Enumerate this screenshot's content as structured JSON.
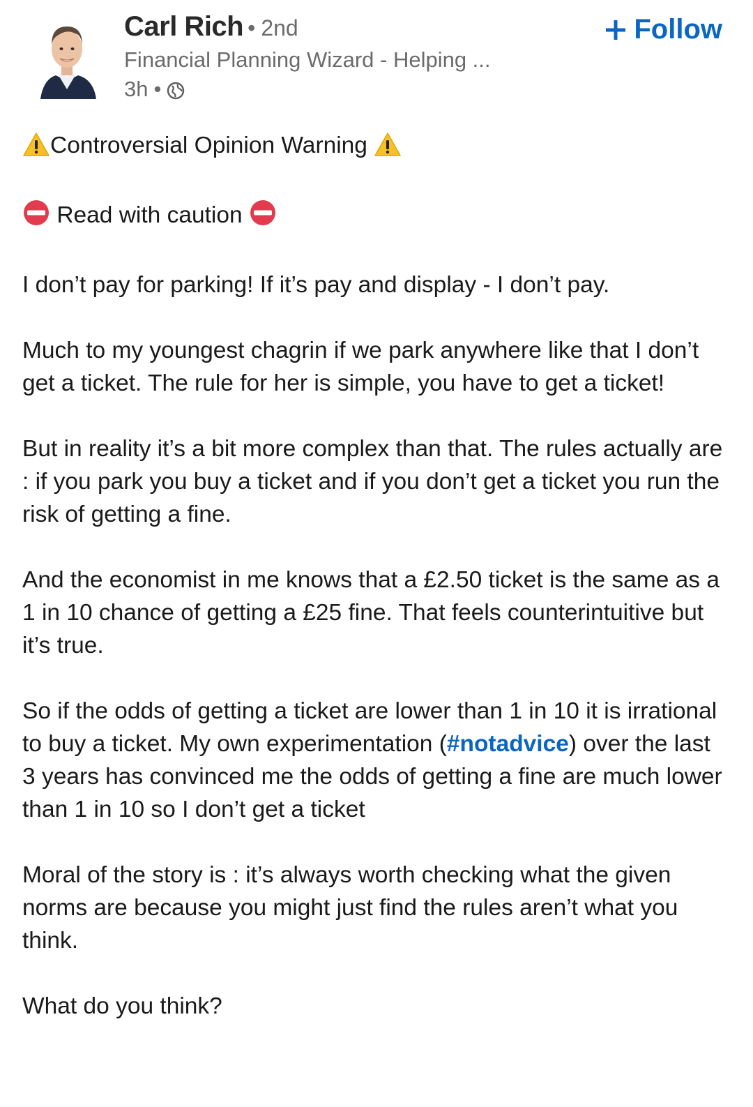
{
  "post": {
    "author": {
      "name": "Carl Rich",
      "connection_separator": "•",
      "degree": "2nd",
      "headline": "Financial Planning Wizard - Helping ...",
      "time": "3h",
      "meta_separator": "•",
      "visibility_icon": "globe-icon"
    },
    "follow_button": {
      "icon": "plus-icon",
      "label": "Follow",
      "color": "#0a66c2"
    },
    "content": {
      "warning_line": "Controversial Opinion Warning",
      "caution_line": "Read with caution",
      "p1": "I don’t pay for parking! If it’s pay and display - I don’t pay.",
      "p2": "Much to my youngest chagrin if we park anywhere like that I don’t get a ticket. The rule for her is simple, you have to get a ticket!",
      "p3": "But in reality it’s a bit more complex than that. The rules actually are : if you park you buy a ticket and if you don’t get a ticket you run the risk of getting a fine.",
      "p4": "And the economist in me knows that a  £2.50 ticket is the same as a 1 in 10 chance of getting a £25 fine. That feels counterintuitive but it’s true.",
      "p5_before": "So if the odds of getting a ticket are lower than 1 in 10 it is irrational to buy a ticket. My own experimentation (",
      "p5_hashtag": "#notadvice",
      "p5_after": ") over the last 3 years has convinced me the odds of getting a fine are much lower than 1 in 10 so I don’t get a ticket",
      "p6": "Moral of the story is : it’s always worth checking what the given norms are because you might just find the rules aren’t what you think.",
      "p7": "What do you think?"
    }
  }
}
